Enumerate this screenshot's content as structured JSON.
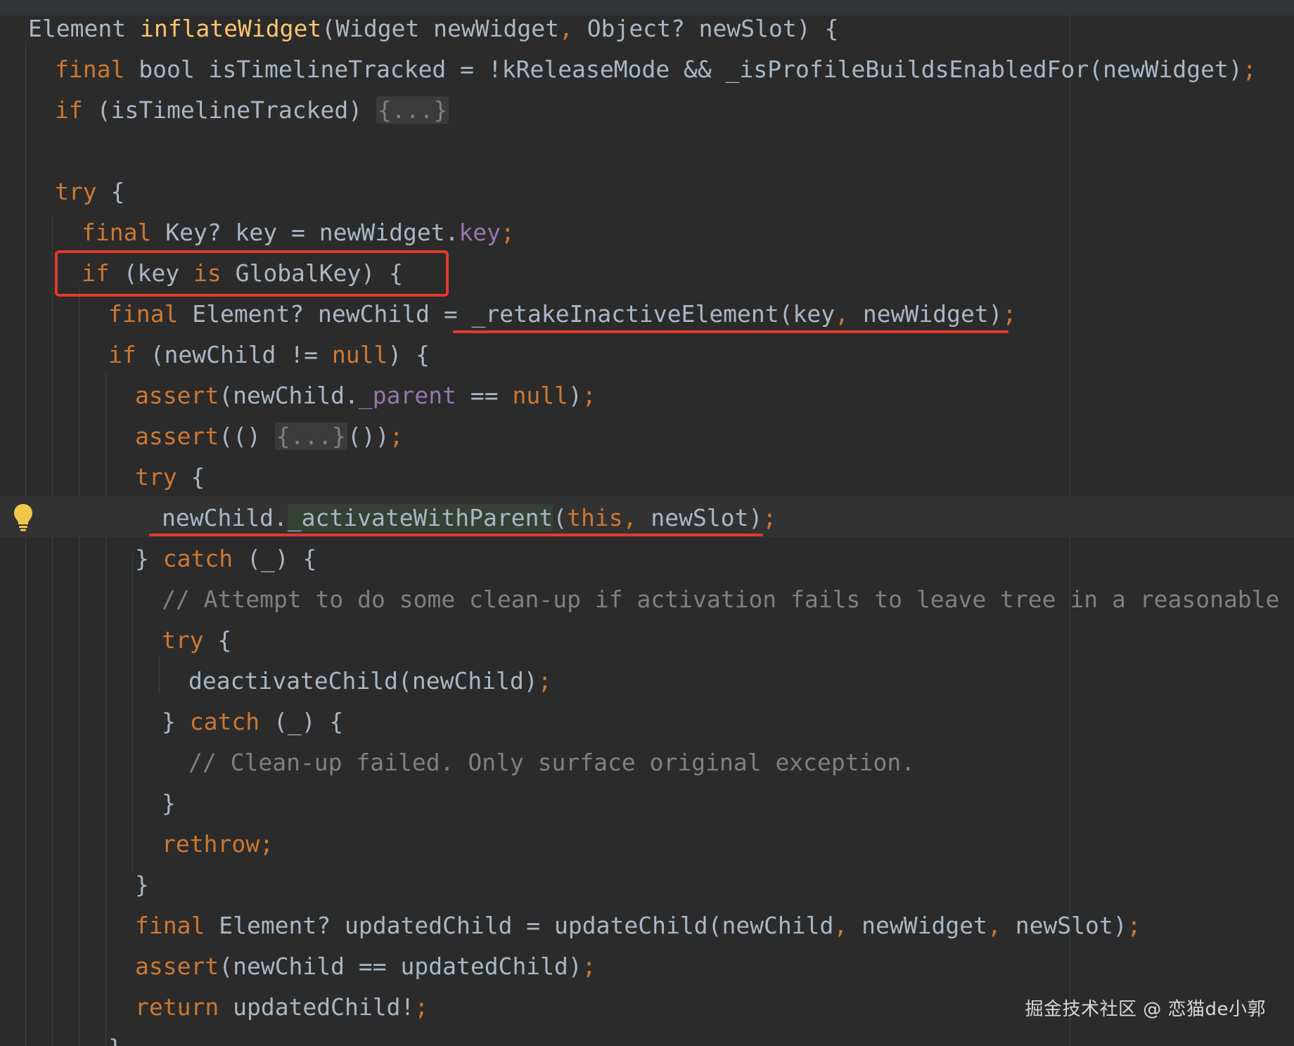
{
  "editor": {
    "lines": [
      {
        "indent": 1,
        "tokens": [
          {
            "t": "Element ",
            "c": "plain"
          },
          {
            "t": "inflateWidget",
            "c": "fn"
          },
          {
            "t": "(Widget newWidget",
            "c": "plain"
          },
          {
            "t": ",",
            "c": "kw"
          },
          {
            "t": " Object? newSlot) {",
            "c": "plain"
          }
        ]
      },
      {
        "indent": 2,
        "tokens": [
          {
            "t": "final",
            "c": "kw"
          },
          {
            "t": " bool isTimelineTracked = !kReleaseMode && _isProfileBuildsEnabledFor(newWidget)",
            "c": "plain"
          },
          {
            "t": ";",
            "c": "kw"
          }
        ]
      },
      {
        "indent": 2,
        "tokens": [
          {
            "t": "if",
            "c": "kw"
          },
          {
            "t": " (isTimelineTracked) ",
            "c": "plain"
          },
          {
            "t": "{...}",
            "c": "fold"
          }
        ]
      },
      {
        "indent": 2,
        "tokens": []
      },
      {
        "indent": 2,
        "tokens": [
          {
            "t": "try",
            "c": "kw"
          },
          {
            "t": " {",
            "c": "plain"
          }
        ]
      },
      {
        "indent": 3,
        "tokens": [
          {
            "t": "final",
            "c": "kw"
          },
          {
            "t": " Key? key = newWidget.",
            "c": "plain"
          },
          {
            "t": "key",
            "c": "prop"
          },
          {
            "t": ";",
            "c": "kw"
          }
        ]
      },
      {
        "indent": 3,
        "tokens": [
          {
            "t": "if",
            "c": "kw"
          },
          {
            "t": " (key ",
            "c": "plain"
          },
          {
            "t": "is",
            "c": "kw"
          },
          {
            "t": " GlobalKey) {",
            "c": "plain"
          }
        ]
      },
      {
        "indent": 4,
        "tokens": [
          {
            "t": "final",
            "c": "kw"
          },
          {
            "t": " Element? newChild = _retakeInactiveElement(key",
            "c": "plain"
          },
          {
            "t": ",",
            "c": "kw"
          },
          {
            "t": " newWidget)",
            "c": "plain"
          },
          {
            "t": ";",
            "c": "kw"
          }
        ]
      },
      {
        "indent": 4,
        "tokens": [
          {
            "t": "if",
            "c": "kw"
          },
          {
            "t": " (newChild != ",
            "c": "plain"
          },
          {
            "t": "null",
            "c": "kw"
          },
          {
            "t": ") {",
            "c": "plain"
          }
        ]
      },
      {
        "indent": 5,
        "tokens": [
          {
            "t": "assert",
            "c": "kw"
          },
          {
            "t": "(newChild.",
            "c": "plain"
          },
          {
            "t": "_parent",
            "c": "prop"
          },
          {
            "t": " == ",
            "c": "plain"
          },
          {
            "t": "null",
            "c": "kw"
          },
          {
            "t": ")",
            "c": "plain"
          },
          {
            "t": ";",
            "c": "kw"
          }
        ]
      },
      {
        "indent": 5,
        "tokens": [
          {
            "t": "assert",
            "c": "kw"
          },
          {
            "t": "(() ",
            "c": "plain"
          },
          {
            "t": "{...}",
            "c": "fold"
          },
          {
            "t": "())",
            "c": "plain"
          },
          {
            "t": ";",
            "c": "kw"
          }
        ]
      },
      {
        "indent": 5,
        "tokens": [
          {
            "t": "try",
            "c": "kw"
          },
          {
            "t": " {",
            "c": "plain"
          }
        ]
      },
      {
        "indent": 6,
        "tokens": [
          {
            "t": "newChild.",
            "c": "plain"
          },
          {
            "t": "_activateWithParent",
            "c": "hl"
          },
          {
            "t": "(",
            "c": "plain"
          },
          {
            "t": "this",
            "c": "kw"
          },
          {
            "t": ",",
            "c": "kw"
          },
          {
            "t": " newSlot)",
            "c": "plain"
          },
          {
            "t": ";",
            "c": "kw"
          }
        ]
      },
      {
        "indent": 5,
        "tokens": [
          {
            "t": "} ",
            "c": "plain"
          },
          {
            "t": "catch",
            "c": "kw"
          },
          {
            "t": " (_) {",
            "c": "plain"
          }
        ]
      },
      {
        "indent": 6,
        "tokens": [
          {
            "t": "// Attempt to do some clean-up if activation fails to leave tree in a reasonable state.",
            "c": "cmt"
          }
        ]
      },
      {
        "indent": 6,
        "tokens": [
          {
            "t": "try",
            "c": "kw"
          },
          {
            "t": " {",
            "c": "plain"
          }
        ]
      },
      {
        "indent": 7,
        "tokens": [
          {
            "t": "deactivateChild(newChild)",
            "c": "plain"
          },
          {
            "t": ";",
            "c": "kw"
          }
        ]
      },
      {
        "indent": 6,
        "tokens": [
          {
            "t": "} ",
            "c": "plain"
          },
          {
            "t": "catch",
            "c": "kw"
          },
          {
            "t": " (_) {",
            "c": "plain"
          }
        ]
      },
      {
        "indent": 7,
        "tokens": [
          {
            "t": "// Clean-up failed. Only surface original exception.",
            "c": "cmt"
          }
        ]
      },
      {
        "indent": 6,
        "tokens": [
          {
            "t": "}",
            "c": "plain"
          }
        ]
      },
      {
        "indent": 6,
        "tokens": [
          {
            "t": "rethrow",
            "c": "kw"
          },
          {
            "t": ";",
            "c": "kw"
          }
        ]
      },
      {
        "indent": 5,
        "tokens": [
          {
            "t": "}",
            "c": "plain"
          }
        ]
      },
      {
        "indent": 5,
        "tokens": [
          {
            "t": "final",
            "c": "kw"
          },
          {
            "t": " Element? updatedChild = updateChild(newChild",
            "c": "plain"
          },
          {
            "t": ",",
            "c": "kw"
          },
          {
            "t": " newWidget",
            "c": "plain"
          },
          {
            "t": ",",
            "c": "kw"
          },
          {
            "t": " newSlot)",
            "c": "plain"
          },
          {
            "t": ";",
            "c": "kw"
          }
        ]
      },
      {
        "indent": 5,
        "tokens": [
          {
            "t": "assert",
            "c": "kw"
          },
          {
            "t": "(newChild == updatedChild)",
            "c": "plain"
          },
          {
            "t": ";",
            "c": "kw"
          }
        ]
      },
      {
        "indent": 5,
        "tokens": [
          {
            "t": "return",
            "c": "kw"
          },
          {
            "t": " updatedChild!",
            "c": "plain"
          },
          {
            "t": ";",
            "c": "kw"
          }
        ]
      },
      {
        "indent": 4,
        "tokens": [
          {
            "t": "}",
            "c": "plain"
          }
        ]
      }
    ]
  },
  "gutter": {
    "intention_icon": "lightbulb-icon",
    "intention_color": "#f0c94b"
  },
  "annotations": {
    "color": "#e4392c"
  },
  "watermark": {
    "text": "掘金技术社区 @ 恋猫de小郭"
  }
}
